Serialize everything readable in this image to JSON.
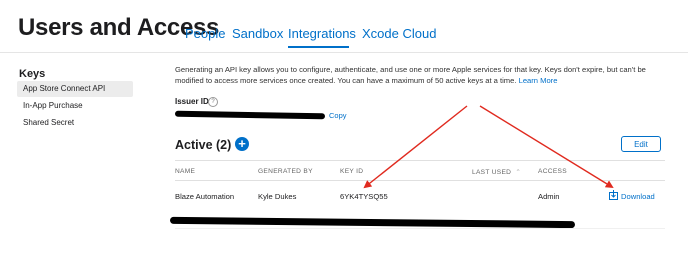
{
  "header": {
    "title": "Users and Access",
    "tabs": [
      {
        "label": "People",
        "active": false
      },
      {
        "label": "Sandbox",
        "active": false
      },
      {
        "label": "Integrations",
        "active": true
      },
      {
        "label": "Xcode Cloud",
        "active": false
      }
    ]
  },
  "sidebar": {
    "heading": "Keys",
    "items": [
      {
        "label": "App Store Connect API",
        "selected": true
      },
      {
        "label": "In-App Purchase",
        "selected": false
      },
      {
        "label": "Shared Secret",
        "selected": false
      }
    ]
  },
  "main": {
    "description": "Generating an API key allows you to configure, authenticate, and use one or more Apple services for that key. Keys don't expire, but can't be modified to access more services once created. You can have a maximum of 50 active keys at a time.",
    "learn_more": "Learn More",
    "issuer_label": "Issuer ID",
    "help_glyph": "?",
    "copy_label": "Copy",
    "active_heading": "Active (2)",
    "add_glyph": "+",
    "edit_label": "Edit",
    "table": {
      "columns": [
        "NAME",
        "GENERATED BY",
        "KEY ID",
        "LAST USED",
        "ACCESS"
      ],
      "sort_glyph": "⌃",
      "rows": [
        {
          "name": "Blaze Automation",
          "generated_by": "Kyle Dukes",
          "key_id": "6YK4TYSQ55",
          "last_used": "",
          "access": "Admin",
          "action": "Download"
        }
      ]
    }
  },
  "colors": {
    "accent": "#0070c9",
    "annotation": "#e02a1f",
    "redaction": "#000000"
  },
  "icons": {
    "add": "plus-circle-icon",
    "download": "download-icon",
    "help": "question-circle-icon"
  }
}
